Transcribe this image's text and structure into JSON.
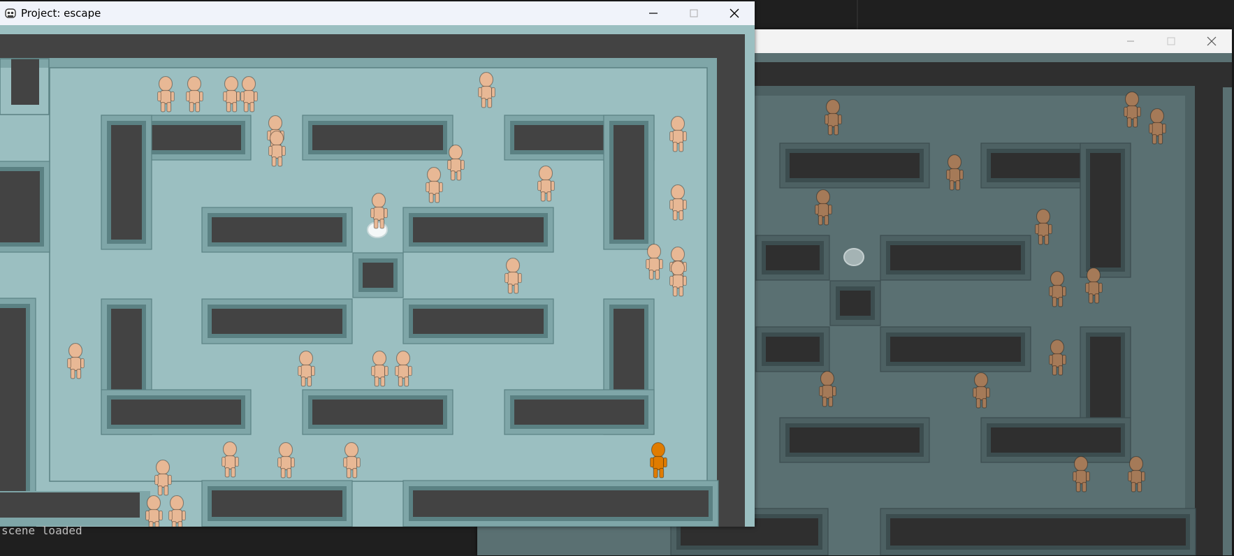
{
  "front_window": {
    "title": "Project: escape",
    "controls": [
      "minimize-icon",
      "maximize-icon",
      "close-icon"
    ]
  },
  "back_window": {
    "title": "",
    "controls": [
      "minimize-icon",
      "maximize-icon",
      "close-icon"
    ]
  },
  "console": {
    "text": "scene loaded"
  },
  "colors": {
    "floor_front": "#9bbfc1",
    "floor_back": "#5a7072",
    "wall_dark": "#434343",
    "rim_light": "#7fa6a8",
    "rim_dark": "#5b8183",
    "character": "#e8b895",
    "character_highlight": "#e07c00",
    "character_back": "#a57a58"
  }
}
